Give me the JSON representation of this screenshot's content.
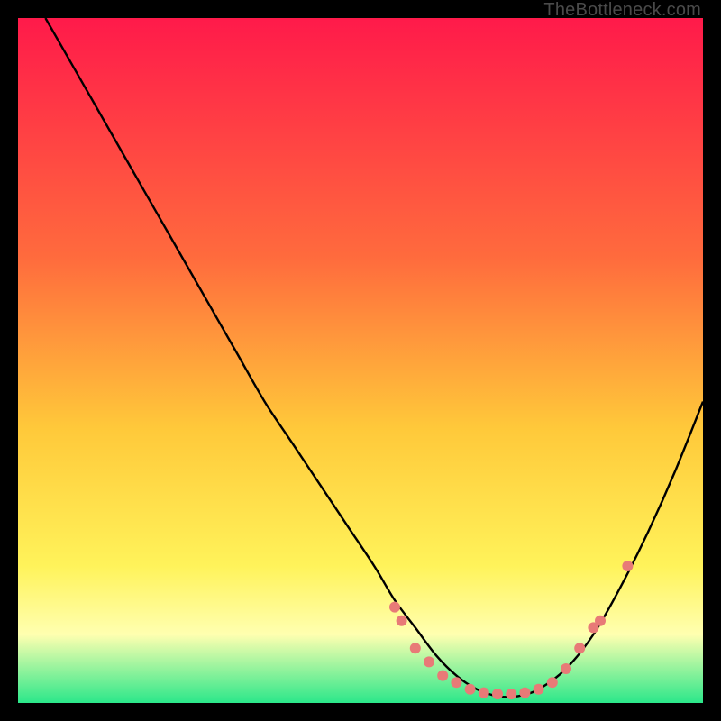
{
  "watermark": "TheBottleneck.com",
  "colors": {
    "black": "#000000",
    "curve": "#000000",
    "dot": "#E87A77",
    "gradient_top": "#FF1A4A",
    "gradient_mid_upper": "#FF6B3D",
    "gradient_mid": "#FFC93A",
    "gradient_mid_lower": "#FFF35A",
    "gradient_pale": "#FFFFB0",
    "gradient_green": "#2BE78A"
  },
  "chart_data": {
    "type": "line",
    "title": "",
    "xlabel": "",
    "ylabel": "",
    "xlim": [
      0,
      100
    ],
    "ylim": [
      0,
      100
    ],
    "legend": false,
    "grid": false,
    "series": [
      {
        "name": "bottleneck-curve",
        "x": [
          4,
          8,
          12,
          16,
          20,
          24,
          28,
          32,
          36,
          40,
          44,
          48,
          52,
          55,
          58,
          61,
          64,
          67,
          70,
          73,
          76,
          80,
          84,
          88,
          92,
          96,
          100
        ],
        "y": [
          100,
          93,
          86,
          79,
          72,
          65,
          58,
          51,
          44,
          38,
          32,
          26,
          20,
          15,
          11,
          7,
          4,
          2,
          1,
          1,
          2,
          5,
          10,
          17,
          25,
          34,
          44
        ]
      }
    ],
    "annotations": [
      {
        "name": "flat-zone-dots",
        "type": "scatter",
        "x": [
          55,
          56,
          58,
          60,
          62,
          64,
          66,
          68,
          70,
          72,
          74,
          76,
          78,
          80,
          82
        ],
        "y": [
          14,
          12,
          8,
          6,
          4,
          3,
          2,
          1.5,
          1.3,
          1.3,
          1.5,
          2,
          3,
          5,
          8
        ]
      },
      {
        "name": "right-arm-dots",
        "type": "scatter",
        "x": [
          84,
          85,
          89
        ],
        "y": [
          11,
          12,
          20
        ]
      }
    ],
    "background": {
      "type": "vertical-gradient",
      "stops": [
        {
          "pos": 0.0,
          "meaning": "severe-bottleneck",
          "color": "#FF1A4A"
        },
        {
          "pos": 0.35,
          "meaning": "high",
          "color": "#FF6B3D"
        },
        {
          "pos": 0.6,
          "meaning": "moderate",
          "color": "#FFC93A"
        },
        {
          "pos": 0.8,
          "meaning": "low",
          "color": "#FFF35A"
        },
        {
          "pos": 0.9,
          "meaning": "minimal",
          "color": "#FFFFB0"
        },
        {
          "pos": 1.0,
          "meaning": "balanced",
          "color": "#2BE78A"
        }
      ]
    }
  }
}
